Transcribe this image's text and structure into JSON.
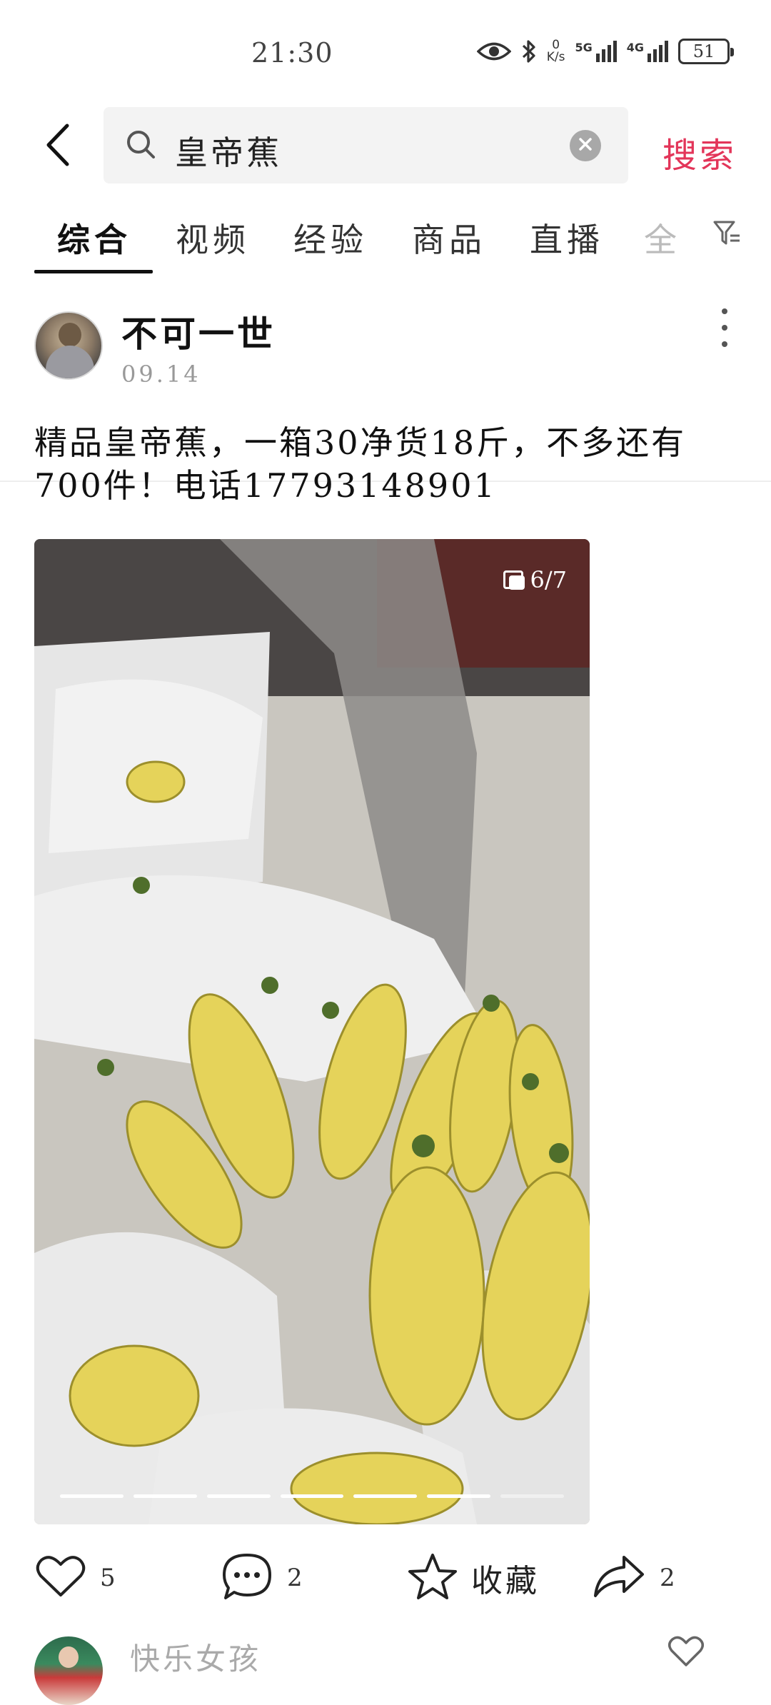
{
  "status_bar": {
    "time": "21:30",
    "net_speed_value": "0",
    "net_speed_unit": "K/s",
    "signal1_label": "5G",
    "signal2_label": "4G",
    "battery": "51"
  },
  "search": {
    "query": "皇帝蕉",
    "search_button": "搜索",
    "icons": {
      "back": "chevron-left-icon",
      "search": "search-icon",
      "clear": "clear-icon",
      "filter": "filter-icon"
    }
  },
  "tabs": [
    {
      "label": "综合",
      "active": true
    },
    {
      "label": "视频"
    },
    {
      "label": "经验"
    },
    {
      "label": "商品"
    },
    {
      "label": "直播"
    },
    {
      "label": "全"
    }
  ],
  "post": {
    "username": "不可一世",
    "date": "09.14",
    "text_line1": "精品皇帝蕉，一箱30净货18斤，不多还有",
    "text_line2": "700件！电话17793148901",
    "image": {
      "counter": "6/7",
      "current_index": 6,
      "total": 7
    },
    "actions": {
      "likes": "5",
      "comments": "2",
      "collect_label": "收藏",
      "shares": "2"
    }
  },
  "comment_preview": {
    "username": "快乐女孩"
  },
  "colors": {
    "accent": "#e33559",
    "text": "#111111",
    "muted": "#999999",
    "search_bg": "#f3f3f3"
  }
}
